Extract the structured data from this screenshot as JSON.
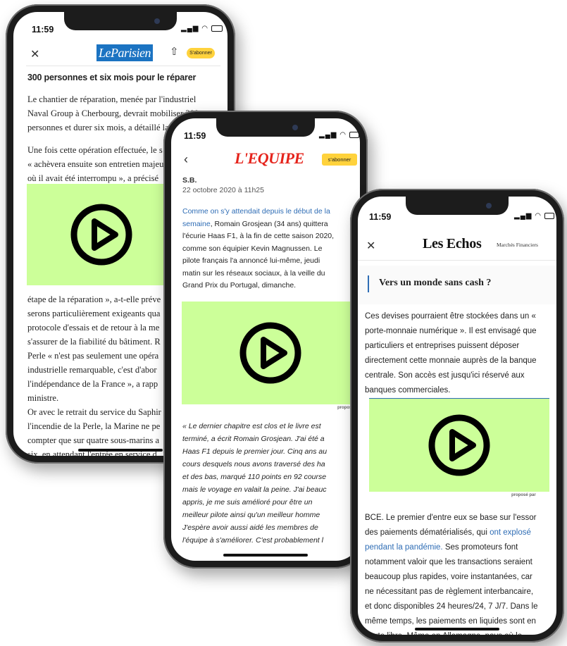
{
  "phones": {
    "parisien": {
      "time": "11:59",
      "logo": "LeParisien",
      "subscribe": "S'abonner",
      "headline": "300 personnes et six mois pour le réparer",
      "p1_lines": [
        "Le chantier de réparation, menée par l'industriel",
        "Naval Group à Cherbourg, devrait mobiliser 300",
        "personnes et durer six mois, a détaillé la"
      ],
      "p2_lines": [
        "Une fois cette opération effectuée, le s",
        "« achèvera ensuite son entretien majeu",
        "où il avait été interrompu », a précisé"
      ],
      "p3_lines": [
        "étape de la réparation », a-t-elle préve",
        "serons particulièrement exigeants qua",
        "protocole d'essais et de retour à la me",
        "s'assurer de la fiabilité du bâtiment. R",
        "Perle « n'est pas seulement une opéra",
        "industrielle remarquable, c'est d'abor",
        "l'indépendance de la France », a rapp",
        "ministre."
      ],
      "p4_lines": [
        "Or avec le retrait du service du Saphir",
        "l'incendie de la Perle, la Marine ne pe",
        "compter que sur quatre sous-marins a",
        "six, en attendant l'entrée en service d"
      ]
    },
    "equipe": {
      "time": "11:59",
      "logo": "L'EQUIPE",
      "subscribe": "s'abonner",
      "author": "S.B.",
      "date": "22 octobre 2020 à 11h25",
      "p1_link_lines": [
        "Comme on s'y attendait depuis le début de la",
        "semaine"
      ],
      "p1_rest": ", Romain Grosjean (34 ans) quittera",
      "p1_lines": [
        "l'écurie Haas F1, à la fin de cette saison 2020,",
        "comme son équipier Kevin Magnussen. Le",
        "pilote français l'a annoncé lui-même, jeudi",
        "matin sur les réseaux sociaux, à la veille du",
        "Grand Prix du Portugal, dimanche."
      ],
      "proposed": "proposé",
      "quote_lines": [
        "« Le dernier chapitre est clos et le livre est",
        "terminé, a écrit Romain Grosjean. J'ai été a",
        "Haas F1 depuis le premier jour. Cinq ans au",
        "cours desquels nous avons traversé des ha",
        "et des bas, marqué 110 points en 92 course",
        "mais le voyage en valait la peine. J'ai beauc",
        "appris, je me suis amélioré pour être un",
        "meilleur pilote ainsi qu'un meilleur homme",
        "J'espère avoir aussi aidé les membres de",
        "l'équipe à s'améliorer. C'est probablement l"
      ]
    },
    "echos": {
      "time": "11:59",
      "logo": "Les Echos",
      "nav": "Marchés Financiers",
      "section": "Vers un monde sans cash ?",
      "p1_lines": [
        "Ces devises pourraient être stockées dans un «",
        "porte-monnaie numérique ». Il est envisagé que",
        "particuliers et entreprises puissent déposer",
        "directement cette monnaie auprès de la banque",
        "centrale. Son accès est jusqu'ici réservé aux",
        "banques commerciales."
      ],
      "proposed": "proposé par",
      "p2_line1": "BCE. Le premier d'entre eux se base sur l'essor",
      "p2_line2_a": "des paiements dématérialisés, qui ",
      "p2_line2_link": "ont explosé",
      "p2_line3_link": "pendant la pandémie.",
      "p2_line3_b": " Ses promoteurs font",
      "p2_lines": [
        "notamment valoir que les transactions seraient",
        "beaucoup plus rapides, voire instantanées, car",
        "ne nécessitant pas de règlement interbancaire,",
        "et donc disponibles 24 heures/24, 7 J/7. Dans le",
        "même temps, les paiements en liquides sont en",
        "chute libre. Même en Allemagne, pays où le"
      ]
    }
  },
  "colors": {
    "video": "#ccff99",
    "parisien_blue": "#1b73c2",
    "equipe_red": "#e5231b",
    "subscribe_yellow": "#ffd23c",
    "link": "#2f6db5"
  },
  "icons": [
    "close-icon",
    "share-icon",
    "back-icon",
    "play-icon",
    "wifi-icon",
    "battery-icon",
    "signal-icon"
  ]
}
